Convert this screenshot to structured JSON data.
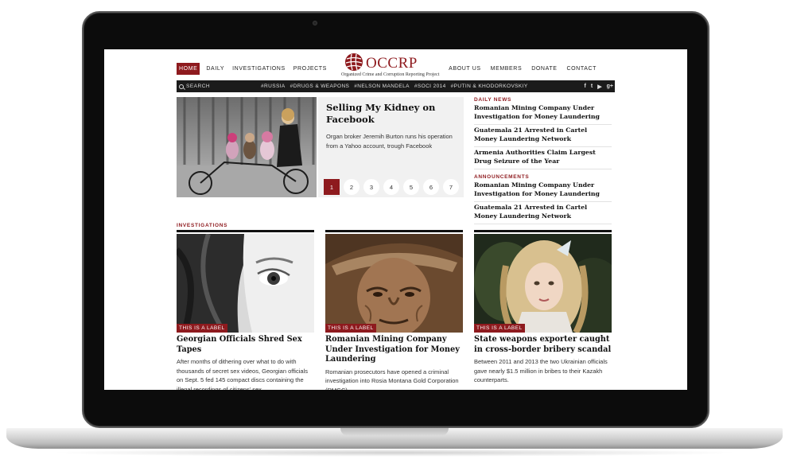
{
  "nav": {
    "left": [
      "Home",
      "Daily",
      "Investigations",
      "Projects"
    ],
    "right": [
      "About Us",
      "Members",
      "Donate",
      "Contact"
    ]
  },
  "logo": {
    "name": "OCCRP",
    "subtitle": "Organized Crime and Corruption Reporting Project"
  },
  "tagbar": {
    "search_label": "SEARCH",
    "tags": [
      "#RUSSIA",
      "#DRUGS & WEAPONS",
      "#NELSON MANDELA",
      "#SOCI 2014",
      "#PUTIN & KHODORKOVSKIY"
    ],
    "socials": [
      "f",
      "t",
      "▶",
      "g+"
    ]
  },
  "feature": {
    "title": "Selling My Kidney on Facebook",
    "summary": "Organ broker Jeremih Burton runs his operation from a Yahoo account, trough Facebook",
    "pages": [
      "1",
      "2",
      "3",
      "4",
      "5",
      "6",
      "7"
    ],
    "active_page": "1"
  },
  "daily_news": {
    "label": "DAILY NEWS",
    "items": [
      "Romanian Mining Company Under Investigation for Money Laundering",
      "Guatemala 21 Arrested in Cartel Money Laundering Network",
      "Armenia Authorities Claim Largest Drug Seizure of the Year"
    ]
  },
  "announcements": {
    "label": "ANNOUNCEMENTS",
    "items": [
      "Romanian Mining Company Under Investigation for Money Laundering",
      "Guatemala 21 Arrested in Cartel Money Laundering Network"
    ]
  },
  "investigations": {
    "label": "INVESTIGATIONS",
    "cards": [
      {
        "badge": "THIS IS A LABEL",
        "title": "Georgian Officials Shred Sex Tapes",
        "text": "After months of dithering over what to do with thousands of secret sex videos, Georgian officials on Sept. 5 fed 145 compact discs containing the illegal recordings of citizens' sex"
      },
      {
        "badge": "THIS IS A LABEL",
        "title": "Romanian Mining Company Under Investigation for Money Laundering",
        "text": "Romanian prosecutors have opened a criminal investigation into Rosia Montana Gold Corporation (RMGC)"
      },
      {
        "badge": "THIS IS A LABEL",
        "title": "State weapons exporter caught in cross-border bribery scandal",
        "text": "Between 2011 and 2013 the two Ukrainian officials gave nearly $1.5 million in bribes to their Kazakh counterparts."
      }
    ]
  },
  "colors": {
    "brand": "#8e1a1e",
    "bar": "#1b1b1b"
  }
}
